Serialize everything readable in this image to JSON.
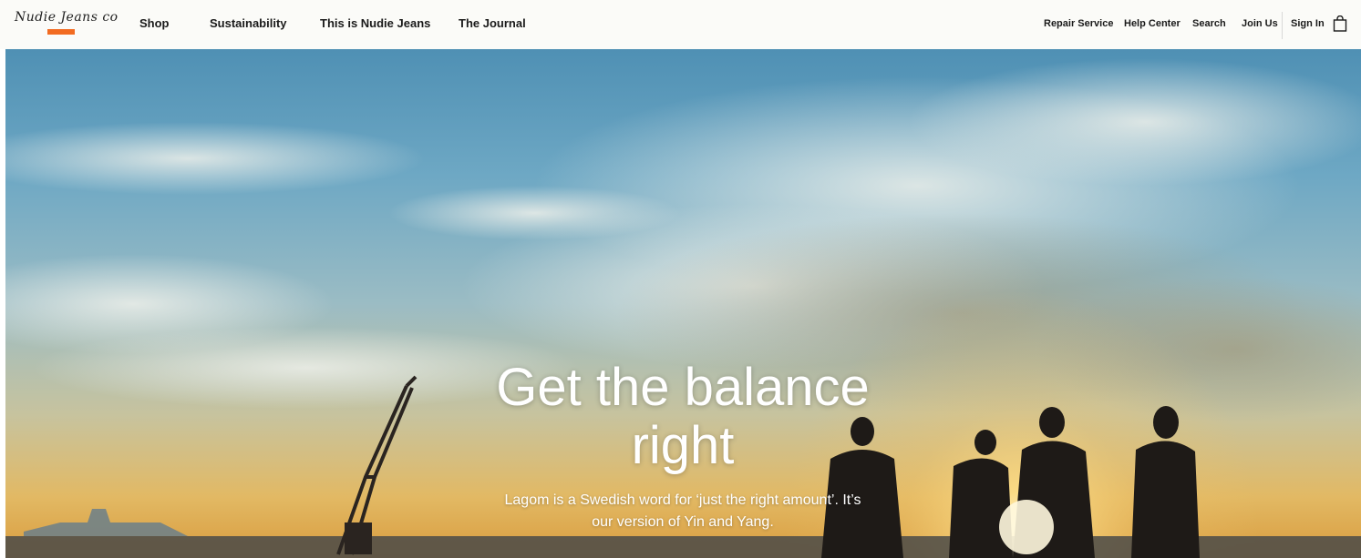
{
  "header": {
    "logo_text": "Nudie Jeans co",
    "nav": [
      {
        "label": "Shop"
      },
      {
        "label": "Sustainability"
      },
      {
        "label": "This is Nudie Jeans"
      },
      {
        "label": "The Journal"
      }
    ],
    "utility": [
      {
        "label": "Repair Service"
      },
      {
        "label": "Help Center"
      },
      {
        "label": "Search"
      },
      {
        "label": "Join Us"
      },
      {
        "label": "Sign In"
      }
    ],
    "bag_icon": "shopping-bag-icon"
  },
  "hero": {
    "title": "Get the balance right",
    "subtitle": "Lagom is a Swedish word for ‘just the right amount’. It’s our version of Yin and Yang."
  },
  "colors": {
    "accent": "#f26b21",
    "header_bg": "#fbfbf8",
    "text": "#1a1a1a"
  }
}
